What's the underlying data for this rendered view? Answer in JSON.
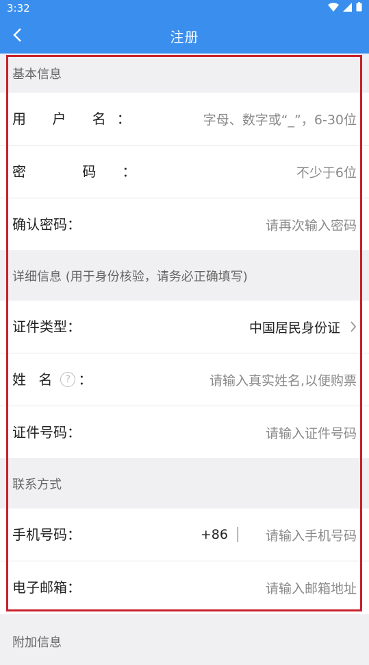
{
  "status": {
    "time": "3:32"
  },
  "header": {
    "title": "注册"
  },
  "basic": {
    "title": "基本信息",
    "username": {
      "label": "用 户 名",
      "placeholder": "字母、数字或“_”，6-30位"
    },
    "password": {
      "label": "密 码",
      "placeholder": "不少于6位"
    },
    "confirm": {
      "label": "确认密码",
      "placeholder": "请再次输入密码"
    }
  },
  "detail": {
    "title": "详细信息 (用于身份核验，请务必正确填写)",
    "idtype": {
      "label": "证件类型",
      "value": "中国居民身份证"
    },
    "name": {
      "label": "姓 名",
      "placeholder": "请输入真实姓名,以便购票"
    },
    "idnum": {
      "label": "证件号码",
      "placeholder": "请输入证件号码"
    }
  },
  "contact": {
    "title": "联系方式",
    "phone": {
      "label": "手机号码",
      "prefix": "+86",
      "placeholder": "请输入手机号码"
    },
    "email": {
      "label": "电子邮箱",
      "placeholder": "请输入邮箱地址"
    }
  },
  "extra": {
    "title": "附加信息"
  },
  "colon": "："
}
